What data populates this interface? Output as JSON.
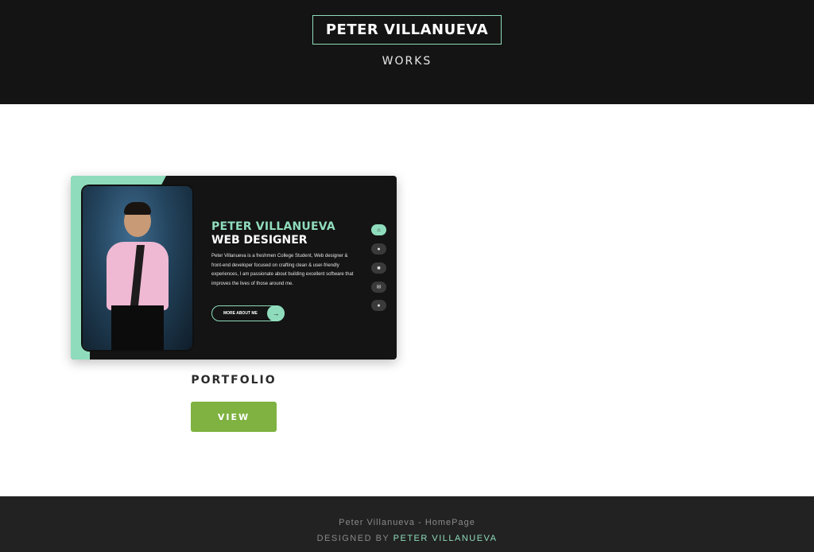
{
  "header": {
    "brand": "PETER VILLANUEVA",
    "subtitle": "WORKS"
  },
  "work": {
    "title": "PORTFOLIO",
    "view_label": "VIEW",
    "preview": {
      "name": "PETER VILLANUEVA",
      "role": "WEB DESIGNER",
      "description": "Peter Villanueva is a freshmen College Student, Web designer & front-end developer focused on crafting clean & user-friendly experiences, I am passionate about building excellent software that improves the lives of those around me.",
      "button_label": "MORE ABOUT ME",
      "button_arrow": "→",
      "nav_icons": [
        {
          "name": "home-icon",
          "glyph": "⌂"
        },
        {
          "name": "user-icon",
          "glyph": "●"
        },
        {
          "name": "briefcase-icon",
          "glyph": "■"
        },
        {
          "name": "envelope-icon",
          "glyph": "✉"
        },
        {
          "name": "chat-icon",
          "glyph": "●"
        }
      ],
      "accent_color": "#8fdcbc"
    }
  },
  "footer": {
    "line1": "Peter Villanueva - HomePage",
    "designed_by": "DESIGNED BY",
    "credit": "PETER VILLANUEVA"
  },
  "colors": {
    "header_bg": "#141414",
    "accent": "#8fdcbc",
    "button": "#7fb241",
    "footer_bg": "#222222"
  }
}
